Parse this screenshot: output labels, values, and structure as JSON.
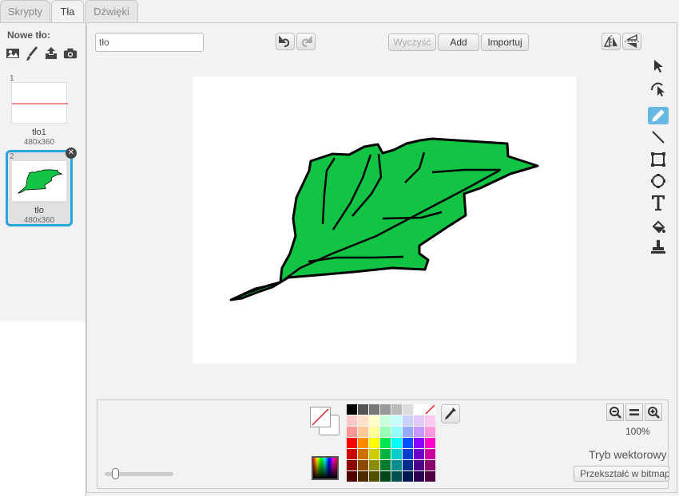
{
  "tabs": [
    {
      "label": "Skrypty"
    },
    {
      "label": "Tła"
    },
    {
      "label": "Dźwięki"
    }
  ],
  "sidebar": {
    "new_label": "Nowe tło:",
    "new_icons": [
      "image-library-icon",
      "paint-brush-icon",
      "upload-icon",
      "camera-icon"
    ],
    "backgrounds": [
      {
        "num": "1",
        "name": "tło1",
        "size": "480x360"
      },
      {
        "num": "2",
        "name": "tło",
        "size": "480x360"
      }
    ]
  },
  "editor": {
    "name_value": "tło",
    "clear_label": "Wyczyść",
    "add_label": "Add",
    "import_label": "Importuj",
    "zoom_level": "100%",
    "mode_label": "Tryb wektorowy",
    "convert_label": "Przekształć w bitmapę",
    "tools": [
      "select-arrow-icon",
      "reshape-icon",
      "pencil-icon",
      "line-icon",
      "rectangle-icon",
      "ellipse-icon",
      "text-icon",
      "fill-bucket-icon",
      "stamp-icon"
    ],
    "active_tool": "pencil-icon"
  },
  "colors": {
    "accent": "#27a5e0",
    "leaf_fill": "#11c443",
    "leaf_stroke": "#000000",
    "palette": [
      [
        "#000000",
        "#555555",
        "#777777",
        "#999999",
        "#bbbbbb",
        "#dddddd",
        "#ffffff",
        "none"
      ],
      [
        "#ffc8c8",
        "#ffe1c8",
        "#ffffc8",
        "#c8ffdc",
        "#c8ffff",
        "#c8d2ff",
        "#e1c8ff",
        "#ffc8f0"
      ],
      [
        "#ff9696",
        "#ffc896",
        "#ffff96",
        "#96ffb4",
        "#96ffff",
        "#96aaff",
        "#c896ff",
        "#ff96e1"
      ],
      [
        "#ff0000",
        "#ff8c00",
        "#ffff00",
        "#00e650",
        "#00ffff",
        "#0050ff",
        "#8c00ff",
        "#ff00c8"
      ],
      [
        "#cc0000",
        "#cc6e00",
        "#cccc00",
        "#00b440",
        "#00cccc",
        "#0040cc",
        "#7000cc",
        "#cc00a0"
      ],
      [
        "#8c0000",
        "#8c4b00",
        "#8c8c00",
        "#007c2c",
        "#008c8c",
        "#002c8c",
        "#4c008c",
        "#8c006e"
      ],
      [
        "#500000",
        "#502b00",
        "#505000",
        "#004618",
        "#005050",
        "#001850",
        "#2b0050",
        "#50003f"
      ]
    ]
  }
}
